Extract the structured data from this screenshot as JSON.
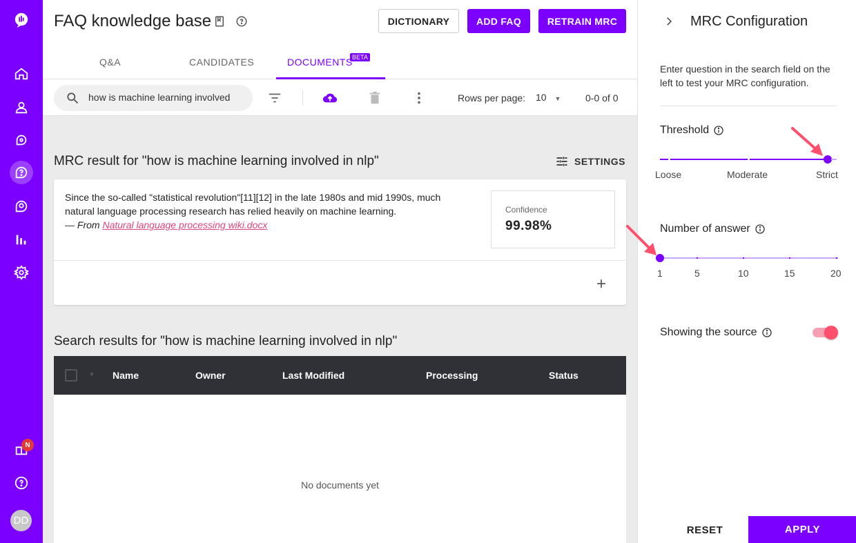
{
  "app": {
    "page_title": "FAQ knowledge base",
    "buttons": {
      "dictionary": "DICTIONARY",
      "add_faq": "ADD FAQ",
      "retrain": "RETRAIN MRC"
    }
  },
  "nav": {
    "items": [
      "home-icon",
      "user-icon",
      "chat-icon",
      "faq-icon",
      "search-chat-icon",
      "analytics-icon",
      "settings-icon"
    ],
    "bottom": {
      "badge": "N",
      "avatar_initials": "DD"
    }
  },
  "tabs": [
    {
      "label": "Q&A",
      "active": false
    },
    {
      "label": "CANDIDATES",
      "active": false
    },
    {
      "label": "DOCUMENTS",
      "active": true,
      "badge": "BETA"
    }
  ],
  "toolbar": {
    "search_value": "how is machine learning involved",
    "rows_per_page_label": "Rows per page:",
    "rows_per_page_value": "10",
    "pagination": "0-0 of 0"
  },
  "mrc": {
    "heading": "MRC result for \"how is machine learning involved in nlp\"",
    "settings_label": "SETTINGS",
    "answer": "Since the so-called \"statistical revolution\"[11][12] in the late 1980s and mid 1990s, much natural language processing research has relied heavily on machine learning.",
    "from_prefix": "— From ",
    "source": "Natural language processing wiki.docx",
    "confidence_label": "Confidence",
    "confidence_value": "99.98%"
  },
  "search_results": {
    "heading": "Search results for \"how is machine learning involved in nlp\"",
    "columns": [
      "Name",
      "Owner",
      "Last Modified",
      "Processing",
      "Status"
    ],
    "rows": [],
    "empty_text": "No documents yet"
  },
  "panel": {
    "title": "MRC Configuration",
    "description": "Enter question in the search field on the left to test your MRC configuration.",
    "threshold": {
      "label": "Threshold",
      "options": [
        "Loose",
        "Moderate",
        "Strict"
      ],
      "selected": "Strict"
    },
    "num_answers": {
      "label": "Number of answer",
      "ticks": [
        "1",
        "5",
        "10",
        "15",
        "20"
      ],
      "value": 1
    },
    "show_source": {
      "label": "Showing the source",
      "on": true
    },
    "reset_label": "RESET",
    "apply_label": "APPLY"
  },
  "colors": {
    "accent": "#7b00ff",
    "pink": "#ff4f6d",
    "table_header": "#2f3136"
  }
}
